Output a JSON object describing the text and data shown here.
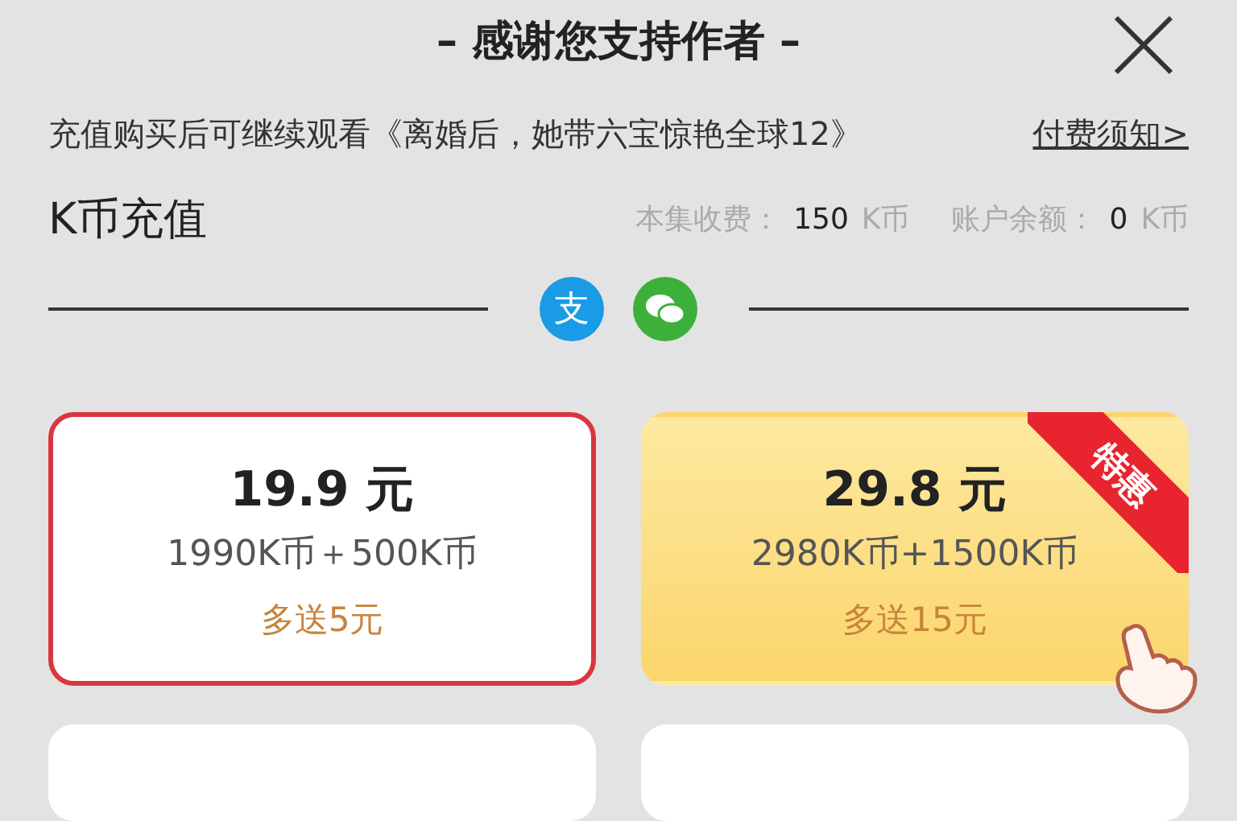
{
  "header": {
    "title": "– 感谢您支持作者 –"
  },
  "notice": {
    "text": "充值购买后可继续观看《离婚后，她带六宝惊艳全球12》",
    "link": "付费须知>"
  },
  "recharge": {
    "title": "K币充值",
    "stats": [
      {
        "label": "本集收费：",
        "value": "150",
        "unit": "K币"
      },
      {
        "label": "账户余额：",
        "value": "0",
        "unit": "K币"
      }
    ]
  },
  "payment_methods": [
    {
      "kind": "alipay",
      "glyph": "支"
    },
    {
      "kind": "wechat"
    }
  ],
  "cards": [
    {
      "kind": "offer",
      "price": "19.9 元",
      "coins": "1990K币＋500K币",
      "bonus": "多送5元",
      "selected": true,
      "promo": false
    },
    {
      "kind": "offer",
      "price": "29.8 元",
      "coins": "2980K币+1500K币",
      "bonus": "多送15元",
      "selected": false,
      "promo": true,
      "badge": "特惠"
    },
    {
      "kind": "partial"
    },
    {
      "kind": "partial"
    }
  ]
}
